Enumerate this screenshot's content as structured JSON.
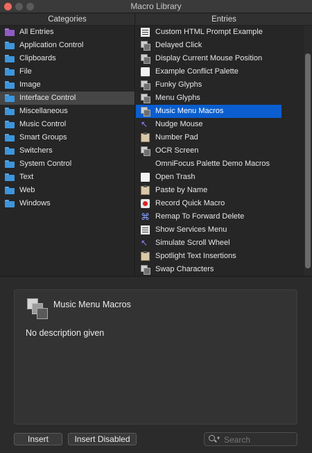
{
  "window": {
    "title": "Macro Library"
  },
  "headers": {
    "categories": "Categories",
    "entries": "Entries"
  },
  "categories": [
    {
      "label": "All Entries",
      "icon": "folder-purple-icon"
    },
    {
      "label": "Application Control",
      "icon": "folder-icon"
    },
    {
      "label": "Clipboards",
      "icon": "folder-icon"
    },
    {
      "label": "File",
      "icon": "folder-icon"
    },
    {
      "label": "Image",
      "icon": "folder-icon"
    },
    {
      "label": "Interface Control",
      "icon": "folder-icon",
      "selected": true
    },
    {
      "label": "Miscellaneous",
      "icon": "folder-icon"
    },
    {
      "label": "Music Control",
      "icon": "folder-icon"
    },
    {
      "label": "Smart Groups",
      "icon": "folder-icon"
    },
    {
      "label": "Switchers",
      "icon": "folder-icon"
    },
    {
      "label": "System Control",
      "icon": "folder-icon"
    },
    {
      "label": "Text",
      "icon": "folder-icon"
    },
    {
      "label": "Web",
      "icon": "folder-icon"
    },
    {
      "label": "Windows",
      "icon": "folder-icon"
    }
  ],
  "entries": [
    {
      "label": "Custom HTML Prompt Example",
      "icon": "list-window-icon"
    },
    {
      "label": "Delayed Click",
      "icon": "macro-stack-icon"
    },
    {
      "label": "Display Current Mouse Position",
      "icon": "macro-stack-icon"
    },
    {
      "label": "Example Conflict Palette",
      "icon": "document-icon"
    },
    {
      "label": "Funky Glyphs",
      "icon": "macro-stack-icon"
    },
    {
      "label": "Menu Glyphs",
      "icon": "macro-stack-icon"
    },
    {
      "label": "Music Menu Macros",
      "icon": "macro-stack-icon",
      "selected": true
    },
    {
      "label": "Nudge Mouse",
      "icon": "mouse-cursor-icon"
    },
    {
      "label": "Number Pad",
      "icon": "clipboard-icon"
    },
    {
      "label": "OCR Screen",
      "icon": "macro-stack-icon"
    },
    {
      "label": "OmniFocus Palette Demo Macros",
      "icon": "none"
    },
    {
      "label": "Open Trash",
      "icon": "document-icon"
    },
    {
      "label": "Paste by Name",
      "icon": "clipboard-icon"
    },
    {
      "label": "Record Quick Macro",
      "icon": "record-icon"
    },
    {
      "label": "Remap To Forward Delete",
      "icon": "command-key-icon"
    },
    {
      "label": "Show Services Menu",
      "icon": "list-window-icon"
    },
    {
      "label": "Simulate Scroll Wheel",
      "icon": "mouse-cursor-icon"
    },
    {
      "label": "Spotlight Text Insertions",
      "icon": "clipboard-icon"
    },
    {
      "label": "Swap Characters",
      "icon": "macro-stack-icon"
    }
  ],
  "detail": {
    "title": "Music Menu Macros",
    "description": "No description given"
  },
  "buttons": {
    "insert": "Insert",
    "insert_disabled": "Insert Disabled"
  },
  "search": {
    "placeholder": "Search",
    "value": ""
  },
  "colors": {
    "selection": "#0a5ecf",
    "folder": "#3d95dc",
    "background": "#2b2b2b"
  }
}
